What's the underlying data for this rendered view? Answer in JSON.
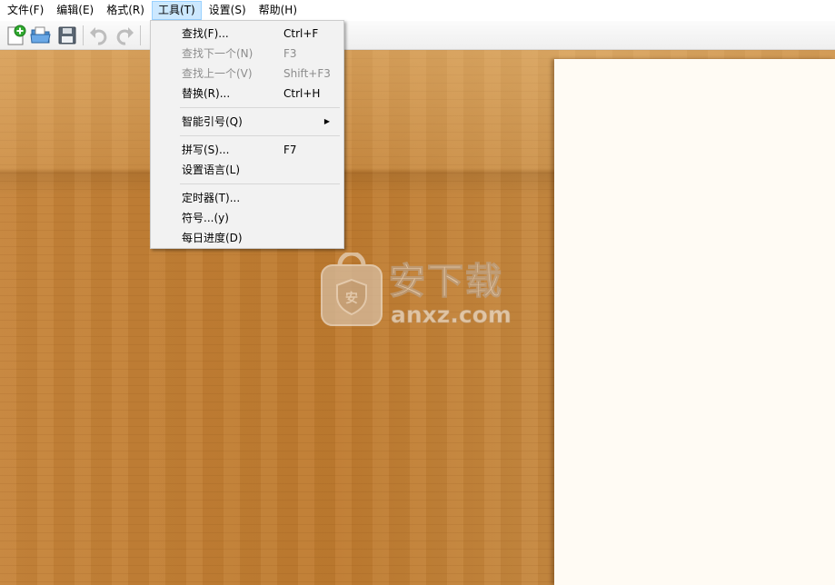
{
  "menubar": {
    "items": [
      {
        "label": "文件(F)"
      },
      {
        "label": "编辑(E)"
      },
      {
        "label": "格式(R)"
      },
      {
        "label": "工具(T)"
      },
      {
        "label": "设置(S)"
      },
      {
        "label": "帮助(H)"
      }
    ]
  },
  "tools_menu": {
    "items": [
      {
        "label": "查找(F)...",
        "shortcut": "Ctrl+F"
      },
      {
        "label": "查找下一个(N)",
        "shortcut": "F3"
      },
      {
        "label": "查找上一个(V)",
        "shortcut": "Shift+F3"
      },
      {
        "label": "替换(R)...",
        "shortcut": "Ctrl+H"
      },
      {
        "label": "智能引号(Q)"
      },
      {
        "label": "拼写(S)...",
        "shortcut": "F7"
      },
      {
        "label": "设置语言(L)"
      },
      {
        "label": "定时器(T)..."
      },
      {
        "label": "符号...(y)"
      },
      {
        "label": "每日进度(D)"
      }
    ]
  },
  "watermark": {
    "text": "安下载",
    "sub": "anxz.com",
    "badge": "安"
  },
  "toolbar_icons": [
    "new-document-icon",
    "open-folder-icon",
    "save-icon",
    "undo-icon",
    "redo-icon"
  ],
  "colors": {
    "menu_highlight": "#cce8ff",
    "desk_wood": "#c27f33",
    "paper": "#fffbf4"
  }
}
